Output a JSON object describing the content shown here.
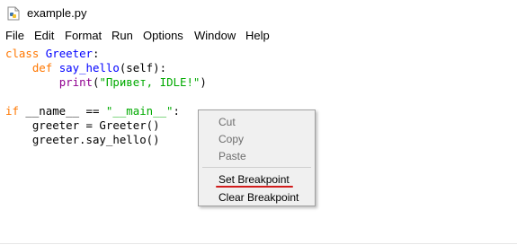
{
  "window": {
    "title": "example.py",
    "icon": "python-file-icon"
  },
  "menubar": {
    "items": [
      "File",
      "Edit",
      "Format",
      "Run",
      "Options",
      "Window",
      "Help"
    ]
  },
  "code": {
    "l1_kw": "class",
    "l1_name": "Greeter",
    "l1_colon": ":",
    "l2_kw": "def",
    "l2_name": "say_hello",
    "l2_rest": "(self):",
    "l3_builtin": "print",
    "l3_open": "(",
    "l3_str": "\"Привет, IDLE!\"",
    "l3_close": ")",
    "l5_kw": "if",
    "l5_mid": " __name__ == ",
    "l5_str": "\"__main__\"",
    "l5_colon": ":",
    "l6": "    greeter = Greeter()",
    "l7": "    greeter.say_hello()"
  },
  "context_menu": {
    "cut": "Cut",
    "copy": "Copy",
    "paste": "Paste",
    "set_breakpoint": "Set Breakpoint",
    "clear_breakpoint": "Clear Breakpoint"
  },
  "colors": {
    "keyword": "#ff7700",
    "definition": "#0000ff",
    "builtin": "#900090",
    "string": "#00aa00",
    "annotation_underline": "#d11b1b"
  }
}
